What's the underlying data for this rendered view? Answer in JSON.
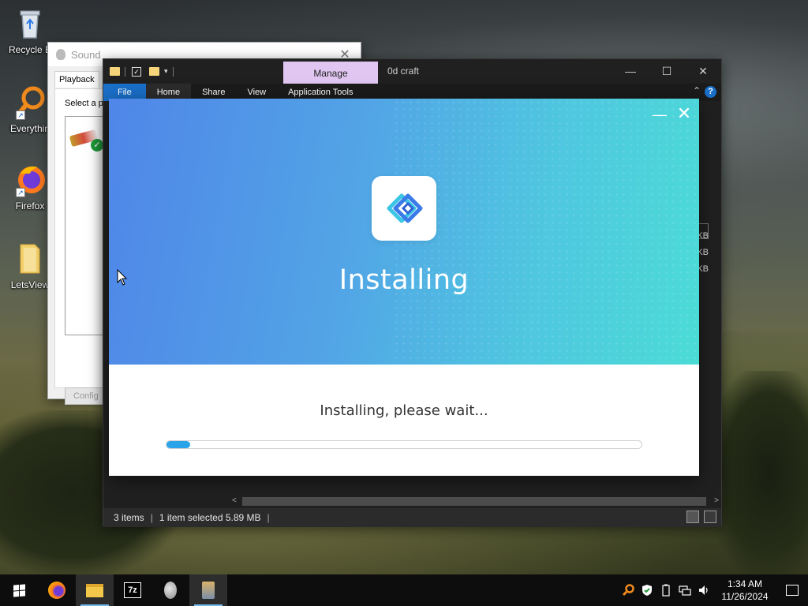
{
  "desktop": {
    "icons": [
      {
        "label": "Recycle B",
        "icon": "recycle-bin-icon"
      },
      {
        "label": "Everythin",
        "icon": "everything-search-icon"
      },
      {
        "label": "Firefox",
        "icon": "firefox-icon"
      },
      {
        "label": "LetsView",
        "icon": "folder-icon"
      }
    ]
  },
  "sound_window": {
    "title": "Sound",
    "close_glyph": "✕",
    "tab_playback": "Playback",
    "select_prompt": "Select a p",
    "configure_label": "Config"
  },
  "explorer": {
    "manage_tab": "Manage",
    "folder_name": "0d craft",
    "ribbon": {
      "file": "File",
      "home": "Home",
      "share": "Share",
      "view": "View",
      "app_tools": "Application Tools"
    },
    "sizes": [
      "KB",
      "KB",
      "KB"
    ],
    "status": {
      "items": "3 items",
      "selected": "1 item selected  5.89 MB",
      "pipe": "|"
    }
  },
  "installer": {
    "title": "Installing",
    "status": "Installing, please wait...",
    "progress_fraction": 0.05,
    "minimize_glyph": "—",
    "close_glyph": "✕",
    "gradient": {
      "start": "#4f86e8",
      "end": "#4bdcd6"
    },
    "progress_color": "#2aa3e8"
  },
  "taskbar": {
    "apps": [
      {
        "icon": "firefox-icon",
        "active": false
      },
      {
        "icon": "file-explorer-icon",
        "active": true
      },
      {
        "icon": "7zip-icon",
        "label": "7z",
        "active": false
      },
      {
        "icon": "app-leaf-icon",
        "active": false
      },
      {
        "icon": "installer-app-icon",
        "active": true
      }
    ],
    "tray": {
      "time": "1:34 AM",
      "date": "11/26/2024"
    }
  }
}
